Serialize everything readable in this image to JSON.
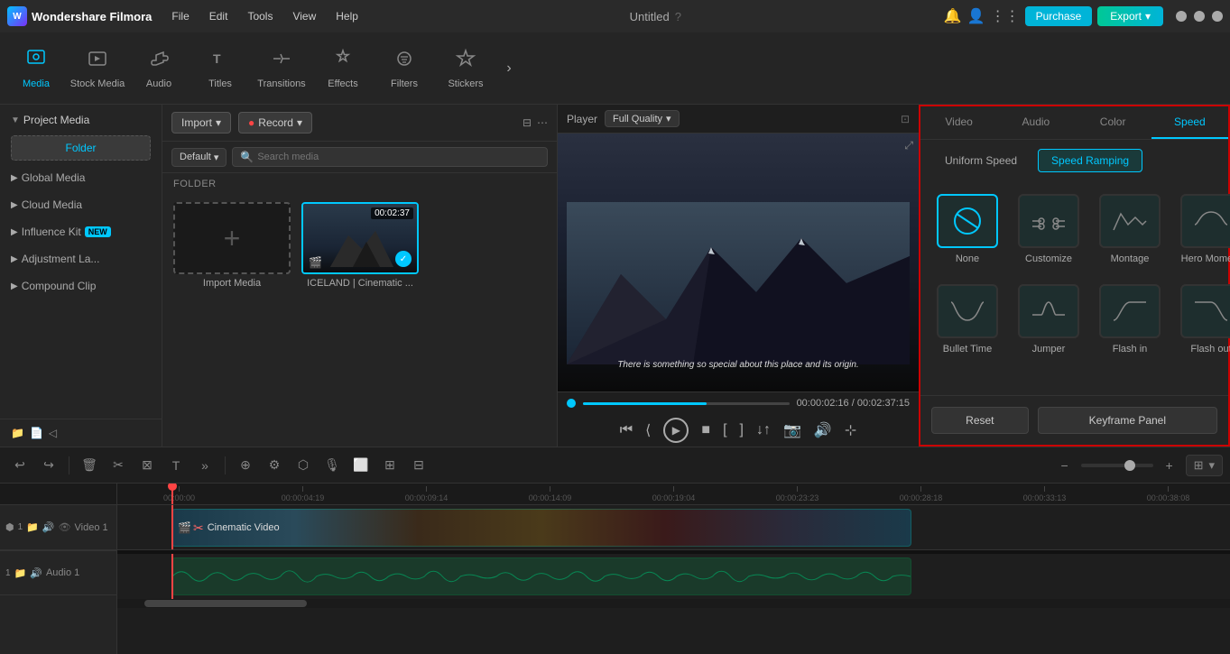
{
  "app": {
    "name": "Wondershare Filmora",
    "title": "Untitled",
    "logo_text": "W"
  },
  "titlebar": {
    "menus": [
      "File",
      "Edit",
      "Tools",
      "View",
      "Help"
    ],
    "purchase_label": "Purchase",
    "export_label": "Export"
  },
  "toolbar": {
    "items": [
      {
        "id": "media",
        "label": "Media",
        "icon": "⬛"
      },
      {
        "id": "stock",
        "label": "Stock Media",
        "icon": "🎬"
      },
      {
        "id": "audio",
        "label": "Audio",
        "icon": "♪"
      },
      {
        "id": "titles",
        "label": "Titles",
        "icon": "T"
      },
      {
        "id": "transitions",
        "label": "Transitions",
        "icon": "◈"
      },
      {
        "id": "effects",
        "label": "Effects",
        "icon": "✦"
      },
      {
        "id": "filters",
        "label": "Filters",
        "icon": "⬡"
      },
      {
        "id": "stickers",
        "label": "Stickers",
        "icon": "★"
      }
    ],
    "more_icon": "›"
  },
  "left_panel": {
    "project_media_label": "Project Media",
    "folder_btn_label": "Folder",
    "sections": [
      {
        "label": "Global Media"
      },
      {
        "label": "Cloud Media"
      },
      {
        "label": "Influence Kit",
        "badge": "NEW"
      },
      {
        "label": "Adjustment La..."
      },
      {
        "label": "Compound Clip"
      }
    ]
  },
  "media_panel": {
    "import_label": "Import",
    "record_label": "Record",
    "default_label": "Default",
    "search_placeholder": "Search media",
    "folder_label": "FOLDER",
    "items": [
      {
        "type": "import",
        "name": "Import Media"
      },
      {
        "type": "video",
        "name": "ICELAND | Cinematic ...",
        "duration": "00:02:37"
      }
    ]
  },
  "preview": {
    "player_label": "Player",
    "quality_label": "Full Quality",
    "caption": "There is something so special about this place and its origin.",
    "current_time": "00:00:02:16",
    "total_time": "00:02:37:15",
    "scrubber_pct": 60
  },
  "right_panel": {
    "tabs": [
      "Video",
      "Audio",
      "Color",
      "Speed"
    ],
    "active_tab": "Speed",
    "speed_subtabs": [
      "Uniform Speed",
      "Speed Ramping"
    ],
    "active_subtab": "Speed Ramping",
    "speed_cards": [
      {
        "id": "none",
        "label": "None",
        "selected": true
      },
      {
        "id": "customize",
        "label": "Customize"
      },
      {
        "id": "montage",
        "label": "Montage"
      },
      {
        "id": "hero_moment",
        "label": "Hero Moment"
      },
      {
        "id": "bullet_time",
        "label": "Bullet Time"
      },
      {
        "id": "jumper",
        "label": "Jumper"
      },
      {
        "id": "flash_in",
        "label": "Flash in"
      },
      {
        "id": "flash_out",
        "label": "Flash out"
      }
    ],
    "reset_label": "Reset",
    "keyframe_label": "Keyframe Panel"
  },
  "timeline": {
    "track_labels": [
      "Video 1",
      "Audio 1"
    ],
    "clip_label": "Cinematic Video",
    "time_marks": [
      "00:00:00",
      "00:00:04:19",
      "00:00:09:14",
      "00:00:14:09",
      "00:00:19:04",
      "00:00:23:23",
      "00:00:28:18",
      "00:00:33:13",
      "00:00:38:08"
    ]
  }
}
